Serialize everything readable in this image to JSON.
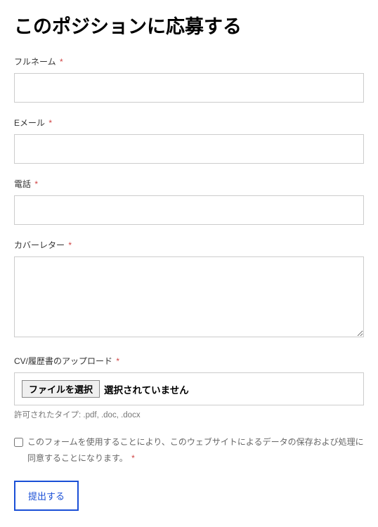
{
  "heading": "このポジションに応募する",
  "fields": {
    "fullname": {
      "label": "フルネーム",
      "value": ""
    },
    "email": {
      "label": "Eメール",
      "value": ""
    },
    "phone": {
      "label": "電話",
      "value": ""
    },
    "cover_letter": {
      "label": "カバーレター",
      "value": ""
    },
    "cv_upload": {
      "label": "CV/履歴書のアップロード",
      "choose_button": "ファイルを選択",
      "status": "選択されていません",
      "hint": "許可されたタイプ: .pdf, .doc, .docx"
    }
  },
  "required_mark": "*",
  "consent": {
    "text": "このフォームを使用することにより、このウェブサイトによるデータの保存および処理に同意することになります。",
    "checked": false
  },
  "submit_label": "提出する"
}
